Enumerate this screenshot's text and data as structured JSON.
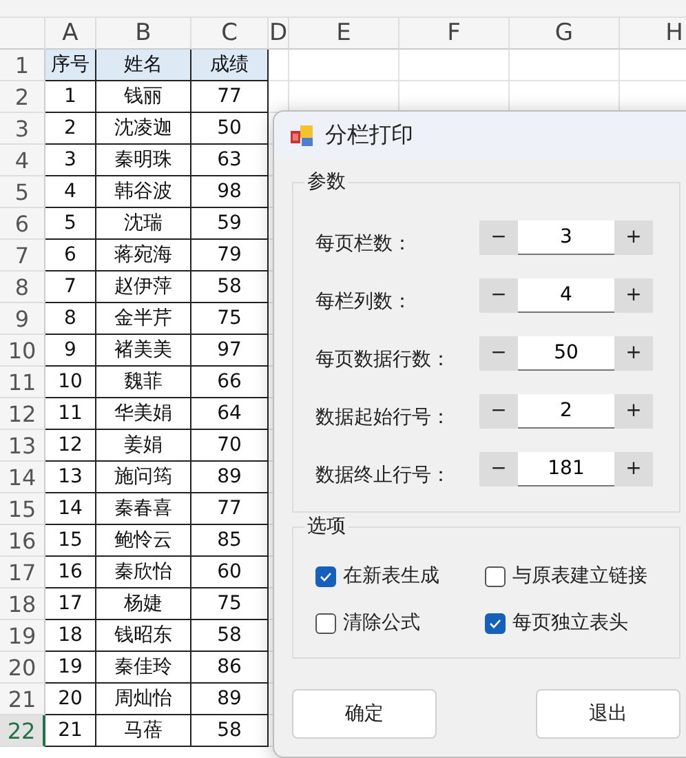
{
  "sheet": {
    "columns": [
      "A",
      "B",
      "C",
      "D",
      "E",
      "F",
      "G",
      "H"
    ],
    "rows": [
      {
        "number": "1",
        "selected": false,
        "cells": [
          "序号",
          "姓名",
          "成绩"
        ],
        "header": true
      },
      {
        "number": "2",
        "selected": false,
        "cells": [
          "1",
          "钱丽",
          "77"
        ]
      },
      {
        "number": "3",
        "selected": false,
        "cells": [
          "2",
          "沈凌迦",
          "50"
        ]
      },
      {
        "number": "4",
        "selected": false,
        "cells": [
          "3",
          "秦明珠",
          "63"
        ]
      },
      {
        "number": "5",
        "selected": false,
        "cells": [
          "4",
          "韩谷波",
          "98"
        ]
      },
      {
        "number": "6",
        "selected": false,
        "cells": [
          "5",
          "沈瑞",
          "59"
        ]
      },
      {
        "number": "7",
        "selected": false,
        "cells": [
          "6",
          "蒋宛海",
          "79"
        ]
      },
      {
        "number": "8",
        "selected": false,
        "cells": [
          "7",
          "赵伊萍",
          "58"
        ]
      },
      {
        "number": "9",
        "selected": false,
        "cells": [
          "8",
          "金半芹",
          "75"
        ]
      },
      {
        "number": "10",
        "selected": false,
        "cells": [
          "9",
          "褚美美",
          "97"
        ]
      },
      {
        "number": "11",
        "selected": false,
        "cells": [
          "10",
          "魏菲",
          "66"
        ]
      },
      {
        "number": "12",
        "selected": false,
        "cells": [
          "11",
          "华美娟",
          "64"
        ]
      },
      {
        "number": "13",
        "selected": false,
        "cells": [
          "12",
          "姜娟",
          "70"
        ]
      },
      {
        "number": "14",
        "selected": false,
        "cells": [
          "13",
          "施问筠",
          "89"
        ]
      },
      {
        "number": "15",
        "selected": false,
        "cells": [
          "14",
          "秦春喜",
          "77"
        ]
      },
      {
        "number": "16",
        "selected": false,
        "cells": [
          "15",
          "鲍怜云",
          "85"
        ]
      },
      {
        "number": "17",
        "selected": false,
        "cells": [
          "16",
          "秦欣怡",
          "60"
        ]
      },
      {
        "number": "18",
        "selected": false,
        "cells": [
          "17",
          "杨婕",
          "75"
        ]
      },
      {
        "number": "19",
        "selected": false,
        "cells": [
          "18",
          "钱昭东",
          "58"
        ]
      },
      {
        "number": "20",
        "selected": false,
        "cells": [
          "19",
          "秦佳玲",
          "86"
        ]
      },
      {
        "number": "21",
        "selected": false,
        "cells": [
          "20",
          "周灿怡",
          "89"
        ]
      },
      {
        "number": "22",
        "selected": true,
        "cells": [
          "21",
          "马蓓",
          "58"
        ]
      }
    ]
  },
  "dialog": {
    "title": "分栏打印",
    "params": {
      "title": "参数",
      "fields": [
        {
          "label": "每页栏数：",
          "value": "3",
          "minus": "−",
          "plus": "+"
        },
        {
          "label": "每栏列数：",
          "value": "4",
          "minus": "−",
          "plus": "+"
        },
        {
          "label": "每页数据行数：",
          "value": "50",
          "minus": "−",
          "plus": "+"
        },
        {
          "label": "数据起始行号：",
          "value": "2",
          "minus": "−",
          "plus": "+"
        },
        {
          "label": "数据终止行号：",
          "value": "181",
          "minus": "−",
          "plus": "+"
        }
      ]
    },
    "options": {
      "title": "选项",
      "items": [
        {
          "label": "在新表生成",
          "checked": true
        },
        {
          "label": "与原表建立链接",
          "checked": false
        },
        {
          "label": "清除公式",
          "checked": false
        },
        {
          "label": "每页独立表头",
          "checked": true
        }
      ]
    },
    "buttons": [
      "确定",
      "退出"
    ]
  }
}
